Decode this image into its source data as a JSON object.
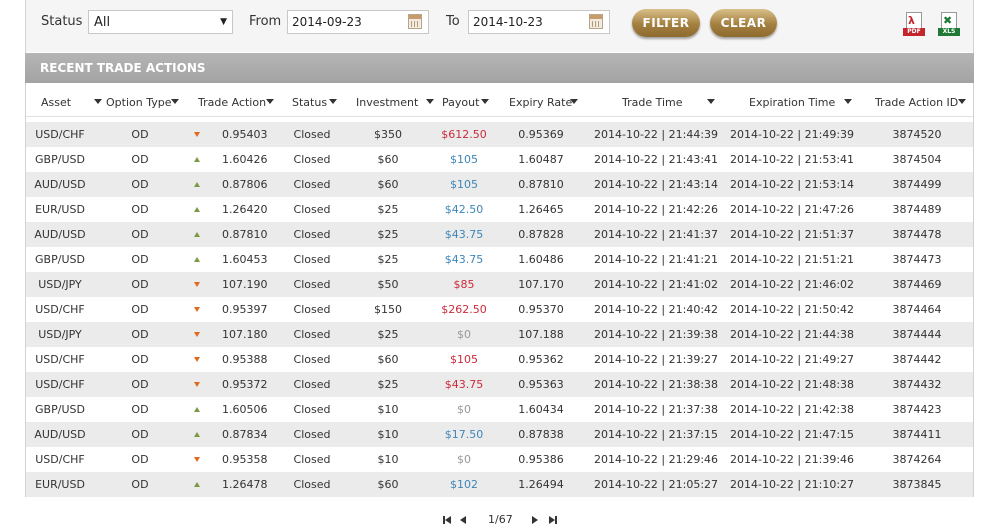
{
  "filters": {
    "status_label": "Status",
    "status_value": "All",
    "from_label": "From",
    "from_value": "2014-09-23",
    "to_label": "To",
    "to_value": "2014-10-23",
    "filter_button": "FILTER",
    "clear_button": "CLEAR",
    "export_pdf_label": "PDF",
    "export_xls_label": "XLS"
  },
  "section_title": "RECENT TRADE ACTIONS",
  "columns": [
    "Asset",
    "Option Type",
    "Trade Action",
    "Status",
    "Investment",
    "Payout",
    "Expiry Rate",
    "Trade Time",
    "Expiration Time",
    "Trade Action ID"
  ],
  "rows": [
    {
      "asset": "USD/CHF",
      "option_type": "OD",
      "direction": "down",
      "rate": "0.95403",
      "status": "Closed",
      "investment": "$350",
      "payout": "$612.50",
      "payout_type": "loss",
      "expiry_rate": "0.95369",
      "trade_time": "2014-10-22 | 21:44:39",
      "expiration_time": "2014-10-22 | 21:49:39",
      "id": "3874520"
    },
    {
      "asset": "GBP/USD",
      "option_type": "OD",
      "direction": "up",
      "rate": "1.60426",
      "status": "Closed",
      "investment": "$60",
      "payout": "$105",
      "payout_type": "win",
      "expiry_rate": "1.60487",
      "trade_time": "2014-10-22 | 21:43:41",
      "expiration_time": "2014-10-22 | 21:53:41",
      "id": "3874504"
    },
    {
      "asset": "AUD/USD",
      "option_type": "OD",
      "direction": "up",
      "rate": "0.87806",
      "status": "Closed",
      "investment": "$60",
      "payout": "$105",
      "payout_type": "win",
      "expiry_rate": "0.87810",
      "trade_time": "2014-10-22 | 21:43:14",
      "expiration_time": "2014-10-22 | 21:53:14",
      "id": "3874499"
    },
    {
      "asset": "EUR/USD",
      "option_type": "OD",
      "direction": "up",
      "rate": "1.26420",
      "status": "Closed",
      "investment": "$25",
      "payout": "$42.50",
      "payout_type": "win",
      "expiry_rate": "1.26465",
      "trade_time": "2014-10-22 | 21:42:26",
      "expiration_time": "2014-10-22 | 21:47:26",
      "id": "3874489"
    },
    {
      "asset": "AUD/USD",
      "option_type": "OD",
      "direction": "up",
      "rate": "0.87810",
      "status": "Closed",
      "investment": "$25",
      "payout": "$43.75",
      "payout_type": "win",
      "expiry_rate": "0.87828",
      "trade_time": "2014-10-22 | 21:41:37",
      "expiration_time": "2014-10-22 | 21:51:37",
      "id": "3874478"
    },
    {
      "asset": "GBP/USD",
      "option_type": "OD",
      "direction": "up",
      "rate": "1.60453",
      "status": "Closed",
      "investment": "$25",
      "payout": "$43.75",
      "payout_type": "win",
      "expiry_rate": "1.60486",
      "trade_time": "2014-10-22 | 21:41:21",
      "expiration_time": "2014-10-22 | 21:51:21",
      "id": "3874473"
    },
    {
      "asset": "USD/JPY",
      "option_type": "OD",
      "direction": "down",
      "rate": "107.190",
      "status": "Closed",
      "investment": "$50",
      "payout": "$85",
      "payout_type": "loss",
      "expiry_rate": "107.170",
      "trade_time": "2014-10-22 | 21:41:02",
      "expiration_time": "2014-10-22 | 21:46:02",
      "id": "3874469"
    },
    {
      "asset": "USD/CHF",
      "option_type": "OD",
      "direction": "down",
      "rate": "0.95397",
      "status": "Closed",
      "investment": "$150",
      "payout": "$262.50",
      "payout_type": "loss",
      "expiry_rate": "0.95370",
      "trade_time": "2014-10-22 | 21:40:42",
      "expiration_time": "2014-10-22 | 21:50:42",
      "id": "3874464"
    },
    {
      "asset": "USD/JPY",
      "option_type": "OD",
      "direction": "down",
      "rate": "107.180",
      "status": "Closed",
      "investment": "$25",
      "payout": "$0",
      "payout_type": "zero",
      "expiry_rate": "107.188",
      "trade_time": "2014-10-22 | 21:39:38",
      "expiration_time": "2014-10-22 | 21:44:38",
      "id": "3874444"
    },
    {
      "asset": "USD/CHF",
      "option_type": "OD",
      "direction": "down",
      "rate": "0.95388",
      "status": "Closed",
      "investment": "$60",
      "payout": "$105",
      "payout_type": "loss",
      "expiry_rate": "0.95362",
      "trade_time": "2014-10-22 | 21:39:27",
      "expiration_time": "2014-10-22 | 21:49:27",
      "id": "3874442"
    },
    {
      "asset": "USD/CHF",
      "option_type": "OD",
      "direction": "down",
      "rate": "0.95372",
      "status": "Closed",
      "investment": "$25",
      "payout": "$43.75",
      "payout_type": "loss",
      "expiry_rate": "0.95363",
      "trade_time": "2014-10-22 | 21:38:38",
      "expiration_time": "2014-10-22 | 21:48:38",
      "id": "3874432"
    },
    {
      "asset": "GBP/USD",
      "option_type": "OD",
      "direction": "up",
      "rate": "1.60506",
      "status": "Closed",
      "investment": "$10",
      "payout": "$0",
      "payout_type": "zero",
      "expiry_rate": "1.60434",
      "trade_time": "2014-10-22 | 21:37:38",
      "expiration_time": "2014-10-22 | 21:42:38",
      "id": "3874423"
    },
    {
      "asset": "AUD/USD",
      "option_type": "OD",
      "direction": "up",
      "rate": "0.87834",
      "status": "Closed",
      "investment": "$10",
      "payout": "$17.50",
      "payout_type": "win",
      "expiry_rate": "0.87838",
      "trade_time": "2014-10-22 | 21:37:15",
      "expiration_time": "2014-10-22 | 21:47:15",
      "id": "3874411"
    },
    {
      "asset": "USD/CHF",
      "option_type": "OD",
      "direction": "down",
      "rate": "0.95358",
      "status": "Closed",
      "investment": "$10",
      "payout": "$0",
      "payout_type": "zero",
      "expiry_rate": "0.95386",
      "trade_time": "2014-10-22 | 21:29:46",
      "expiration_time": "2014-10-22 | 21:39:46",
      "id": "3874264"
    },
    {
      "asset": "EUR/USD",
      "option_type": "OD",
      "direction": "up",
      "rate": "1.26478",
      "status": "Closed",
      "investment": "$60",
      "payout": "$102",
      "payout_type": "win",
      "expiry_rate": "1.26494",
      "trade_time": "2014-10-22 | 21:05:27",
      "expiration_time": "2014-10-22 | 21:10:27",
      "id": "3873845"
    }
  ],
  "pagination": {
    "page_text": "1/67"
  },
  "colors": {
    "payout_win": "#3f86b8",
    "payout_loss": "#cc2a3c",
    "payout_zero": "#999999",
    "arrow_up": "#7a9a44",
    "arrow_down": "#e06a1c",
    "button_gold": "#a48040",
    "title_bar": "#a8a8a8"
  },
  "icons": {
    "pdf": "pdf-export-icon",
    "xls": "xls-export-icon",
    "calendar": "calendar-icon"
  }
}
